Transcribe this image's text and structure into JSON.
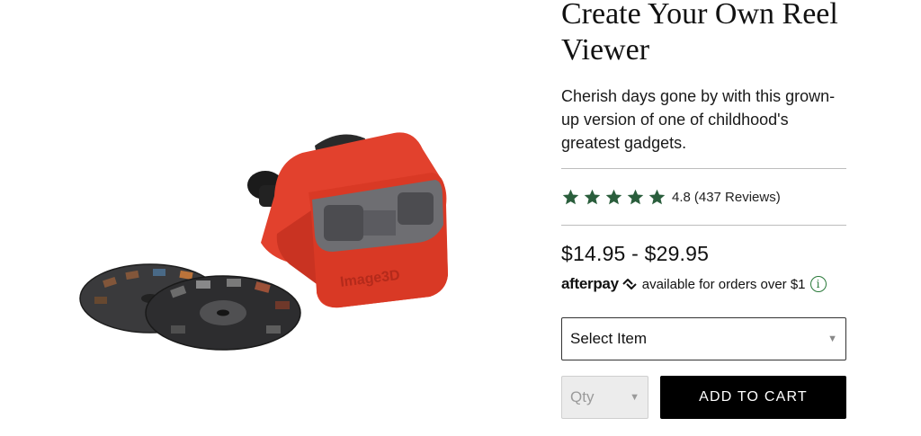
{
  "product": {
    "title": "Create Your Own Reel Viewer",
    "description": "Cherish days gone by with this grown-up version of one of childhood's greatest gadgets.",
    "image_alt": "Red reel viewer with picture reels",
    "viewer_brand_text": "Image3D"
  },
  "rating": {
    "stars": 5,
    "value_text": "4.8",
    "reviews_text": "(437 Reviews)",
    "star_color": "#2a5e3c"
  },
  "pricing": {
    "price_range": "$14.95 - $29.95",
    "afterpay_logo": "afterpay",
    "afterpay_text": "available for orders over $1",
    "info_icon": "i"
  },
  "purchase": {
    "select_label": "Select Item",
    "qty_label": "Qty",
    "add_to_cart_label": "ADD TO CART",
    "button_color": "#000000"
  }
}
